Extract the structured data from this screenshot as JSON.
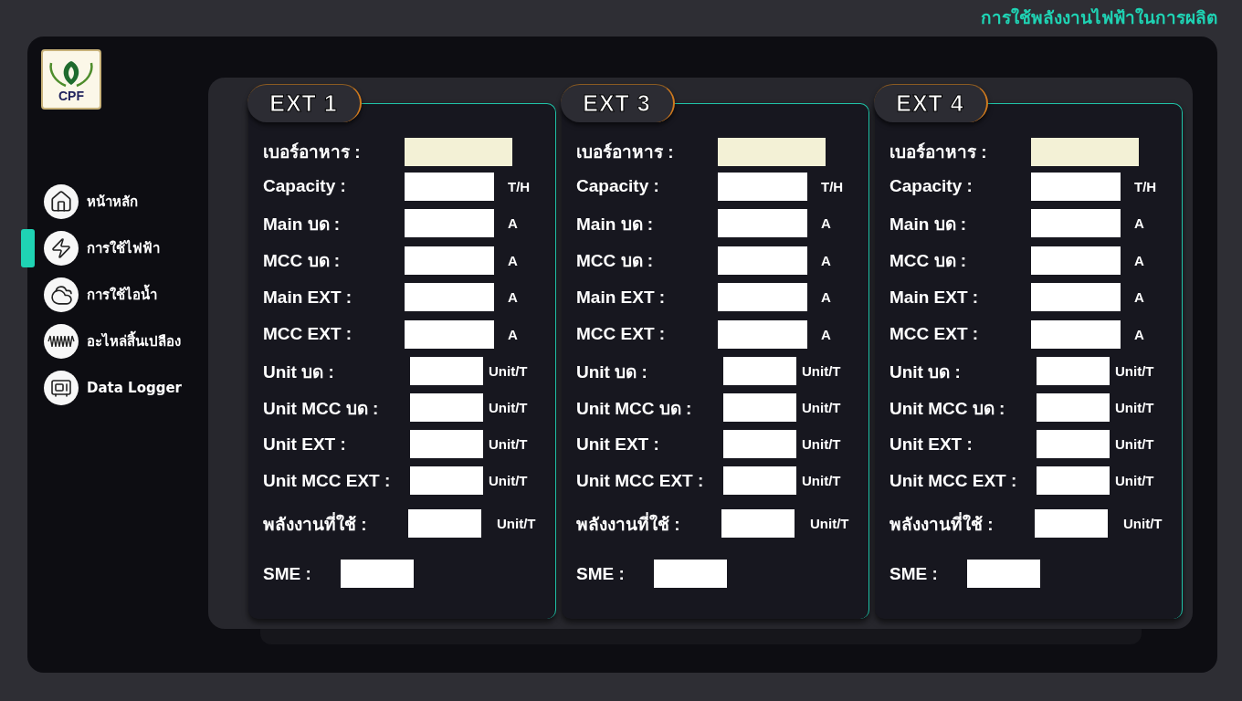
{
  "header": {
    "title": "การใช้พลังงานไฟฟ้าในการผลิต"
  },
  "logo": {
    "text": "CPF"
  },
  "sidebar": {
    "items": [
      {
        "kind": "home",
        "label": "หน้าหลัก",
        "selected": false
      },
      {
        "kind": "power",
        "label": "การใช้ไฟฟ้า",
        "selected": true
      },
      {
        "kind": "steam",
        "label": "การใช้ไอน้ำ",
        "selected": false
      },
      {
        "kind": "coil",
        "label": "อะไหล่สิ้นเปลือง",
        "selected": false
      },
      {
        "kind": "logger",
        "label": "Data Logger",
        "selected": false
      }
    ]
  },
  "cards": [
    {
      "title": "EXT 1",
      "rows": [
        {
          "kind": "name",
          "label": "เบอร์อาหาร :"
        },
        {
          "kind": "main",
          "label": "Capacity :",
          "unit": "T/H"
        },
        {
          "kind": "main",
          "label": "Main บด :",
          "unit": "A"
        },
        {
          "kind": "main",
          "label": "MCC บด :",
          "unit": "A"
        },
        {
          "kind": "main",
          "label": "Main EXT :",
          "unit": "A"
        },
        {
          "kind": "main",
          "label": "MCC EXT :",
          "unit": "A"
        },
        {
          "kind": "unit",
          "label": "Unit บด :",
          "unit": "Unit/T"
        },
        {
          "kind": "unit",
          "label": "Unit MCC บด :",
          "unit": "Unit/T"
        },
        {
          "kind": "unit",
          "label": "Unit EXT :",
          "unit": "Unit/T"
        },
        {
          "kind": "unit",
          "label": "Unit MCC EXT :",
          "unit": "Unit/T"
        },
        {
          "kind": "total",
          "label": "พลังงานที่ใช้ :",
          "unit": "Unit/T"
        },
        {
          "kind": "sme",
          "label": "SME :"
        }
      ]
    },
    {
      "title": "EXT 3",
      "rows": [
        {
          "kind": "name",
          "label": "เบอร์อาหาร :"
        },
        {
          "kind": "main",
          "label": "Capacity :",
          "unit": "T/H"
        },
        {
          "kind": "main",
          "label": "Main บด :",
          "unit": "A"
        },
        {
          "kind": "main",
          "label": "MCC บด :",
          "unit": "A"
        },
        {
          "kind": "main",
          "label": "Main EXT :",
          "unit": "A"
        },
        {
          "kind": "main",
          "label": "MCC EXT :",
          "unit": "A"
        },
        {
          "kind": "unit",
          "label": "Unit บด :",
          "unit": "Unit/T"
        },
        {
          "kind": "unit",
          "label": "Unit MCC บด :",
          "unit": "Unit/T"
        },
        {
          "kind": "unit",
          "label": "Unit EXT :",
          "unit": "Unit/T"
        },
        {
          "kind": "unit",
          "label": "Unit MCC EXT :",
          "unit": "Unit/T"
        },
        {
          "kind": "total",
          "label": "พลังงานที่ใช้ :",
          "unit": "Unit/T"
        },
        {
          "kind": "sme",
          "label": "SME :"
        }
      ]
    },
    {
      "title": "EXT 4",
      "rows": [
        {
          "kind": "name",
          "label": "เบอร์อาหาร :"
        },
        {
          "kind": "main",
          "label": "Capacity :",
          "unit": "T/H"
        },
        {
          "kind": "main",
          "label": "Main บด :",
          "unit": "A"
        },
        {
          "kind": "main",
          "label": "MCC บด :",
          "unit": "A"
        },
        {
          "kind": "main",
          "label": "Main EXT :",
          "unit": "A"
        },
        {
          "kind": "main",
          "label": "MCC EXT :",
          "unit": "A"
        },
        {
          "kind": "unit",
          "label": "Unit บด :",
          "unit": "Unit/T"
        },
        {
          "kind": "unit",
          "label": "Unit MCC บด :",
          "unit": "Unit/T"
        },
        {
          "kind": "unit",
          "label": "Unit EXT :",
          "unit": "Unit/T"
        },
        {
          "kind": "unit",
          "label": "Unit MCC EXT :",
          "unit": "Unit/T"
        },
        {
          "kind": "total",
          "label": "พลังงานที่ใช้ :",
          "unit": "Unit/T"
        },
        {
          "kind": "sme",
          "label": "SME :"
        }
      ]
    }
  ]
}
